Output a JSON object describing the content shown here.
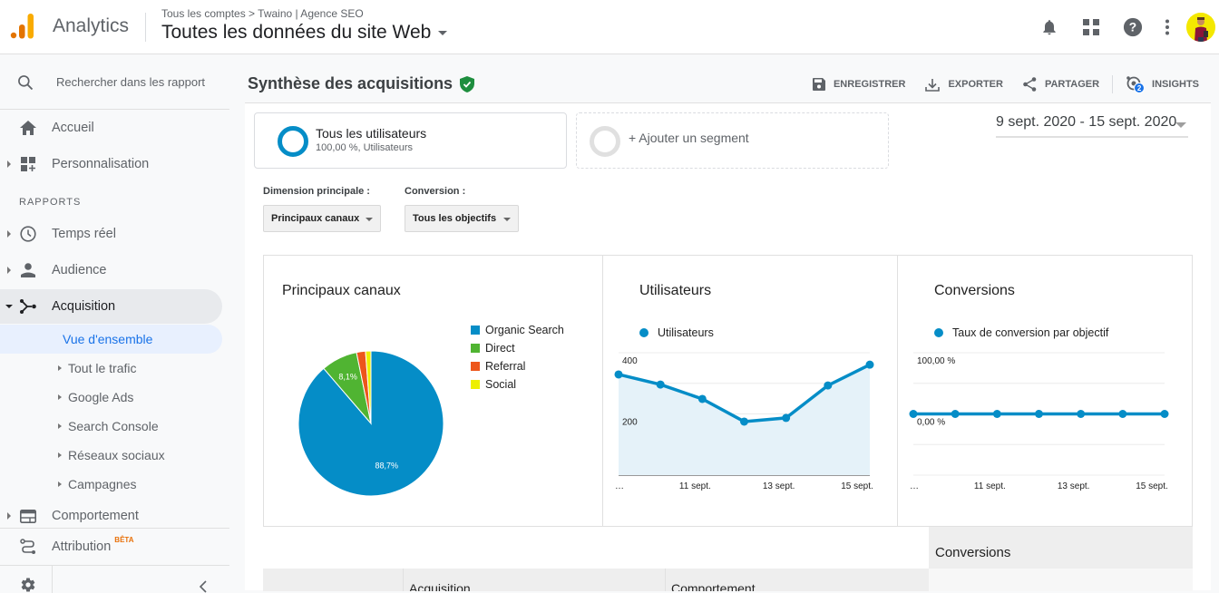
{
  "header": {
    "app_name": "Analytics",
    "breadcrumb": "Tous les comptes > Twaino | Agence SEO",
    "view_title": "Toutes les données du site Web",
    "icons": [
      "bell-icon",
      "apps-grid-icon",
      "help-icon",
      "more-vert-icon",
      "avatar"
    ]
  },
  "sidebar": {
    "search_placeholder": "Rechercher dans les rapport",
    "items_top": [
      {
        "label": "Accueil",
        "icon": "home-icon"
      },
      {
        "label": "Personnalisation",
        "icon": "dashboard-add-icon"
      }
    ],
    "section_label": "RAPPORTS",
    "reports": [
      {
        "label": "Temps réel",
        "icon": "clock-icon"
      },
      {
        "label": "Audience",
        "icon": "person-icon"
      },
      {
        "label": "Acquisition",
        "icon": "acquisition-icon",
        "expanded": true
      }
    ],
    "acquisition_sub": [
      {
        "label": "Vue d'ensemble",
        "selected": true
      },
      {
        "label": "Tout le trafic"
      },
      {
        "label": "Google Ads"
      },
      {
        "label": "Search Console"
      },
      {
        "label": "Réseaux sociaux"
      },
      {
        "label": "Campagnes"
      }
    ],
    "comportement": "Comportement",
    "attribution": "Attribution",
    "attribution_badge": "BÊTA"
  },
  "page": {
    "title": "Synthèse des acquisitions",
    "actions": {
      "save": "ENREGISTRER",
      "export": "EXPORTER",
      "share": "PARTAGER",
      "insights": "INSIGHTS",
      "insights_count": "2"
    },
    "segment1": {
      "name": "Tous les utilisateurs",
      "detail": "100,00 %, Utilisateurs"
    },
    "segment2": {
      "name": "+ Ajouter un segment"
    },
    "date_range": "9 sept. 2020 - 15 sept. 2020",
    "dim_label": "Dimension principale :",
    "dim_value": "Principaux canaux",
    "conv_label": "Conversion :",
    "conv_value": "Tous les objectifs"
  },
  "chart_data": [
    {
      "type": "pie",
      "title": "Principaux canaux",
      "categories": [
        "Organic Search",
        "Direct",
        "Referral",
        "Social"
      ],
      "values": [
        88.7,
        8.1,
        2.0,
        1.2
      ],
      "colors": [
        "#058dc7",
        "#50b432",
        "#ed561b",
        "#edef00"
      ],
      "data_labels": [
        "88,7%",
        "8,1%",
        "",
        ""
      ],
      "legend": "right"
    },
    {
      "type": "area",
      "title": "Utilisateurs",
      "series": [
        {
          "name": "Utilisateurs",
          "values": [
            329,
            296,
            249,
            175,
            187,
            293,
            361
          ]
        }
      ],
      "x": [
        "9 sept.",
        "10 sept.",
        "11 sept.",
        "12 sept.",
        "13 sept.",
        "14 sept.",
        "15 sept."
      ],
      "x_tick_labels": [
        "…",
        "11 sept.",
        "13 sept.",
        "15 sept."
      ],
      "y_tick_labels": [
        "400",
        "200"
      ],
      "ylim": [
        0,
        400
      ],
      "color": "#058dc7",
      "legend": "top-left"
    },
    {
      "type": "line",
      "title": "Conversions",
      "series": [
        {
          "name": "Taux de conversion par objectif",
          "values": [
            0,
            0,
            0,
            0,
            0,
            0,
            0
          ]
        }
      ],
      "x": [
        "9 sept.",
        "10 sept.",
        "11 sept.",
        "12 sept.",
        "13 sept.",
        "14 sept.",
        "15 sept."
      ],
      "x_tick_labels": [
        "…",
        "11 sept.",
        "13 sept.",
        "15 sept."
      ],
      "y_tick_labels": [
        "100,00 %",
        "0,00 %"
      ],
      "ylim": [
        -100,
        100
      ],
      "color": "#058dc7",
      "legend": "top-left"
    }
  ],
  "table": {
    "conversions_header": "Conversions",
    "col_acquisition": "Acquisition",
    "col_comportement": "Comportement"
  }
}
